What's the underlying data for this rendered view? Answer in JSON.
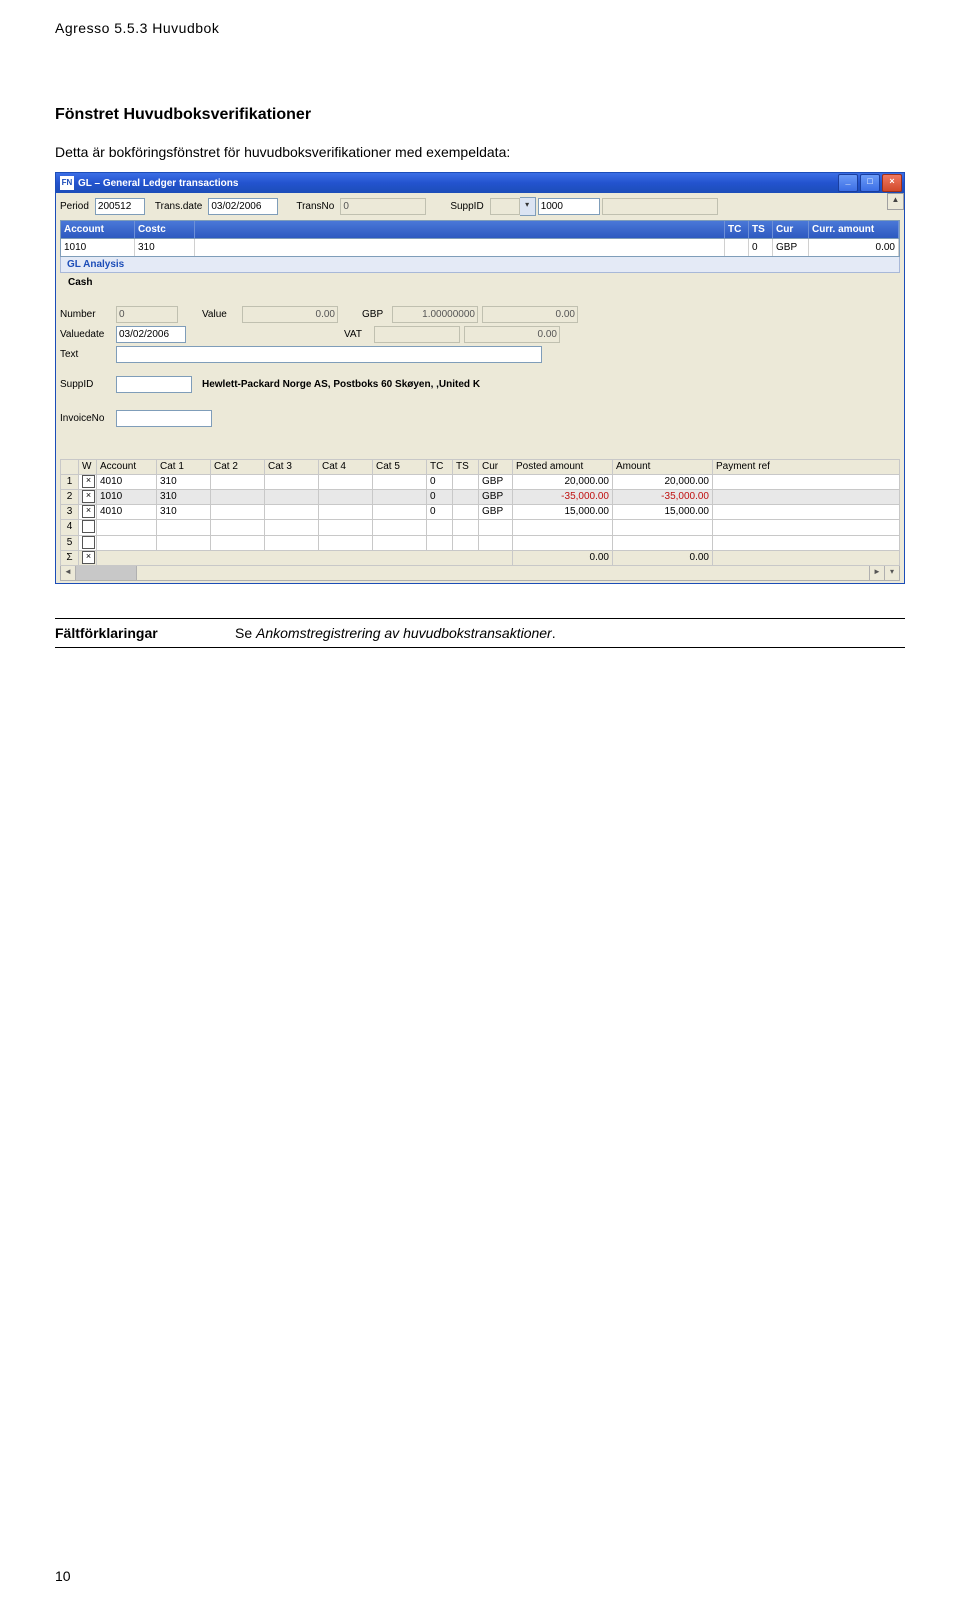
{
  "doc": {
    "running_head": "Agresso 5.5.3 Huvudbok",
    "section_title": "Fönstret Huvudboksverifikationer",
    "intro": "Detta är bokföringsfönstret för huvudboksverifikationer med exempeldata:",
    "page_number": "10"
  },
  "win": {
    "icon_text": "FN",
    "title": "GL – General Ledger transactions",
    "min": "_",
    "max": "□",
    "close": "×",
    "scroll_up": "▲"
  },
  "topline": {
    "period_lbl": "Period",
    "period_val": "200512",
    "transdate_lbl": "Trans.date",
    "transdate_val": "03/02/2006",
    "transno_lbl": "TransNo",
    "transno_val": "0",
    "suppid_lbl": "SuppID",
    "suppid_val": "1000",
    "dd": "▾"
  },
  "ht_headers": {
    "account": "Account",
    "costc": "Costc",
    "tc": "TC",
    "ts": "TS",
    "cur": "Cur",
    "curramt": "Curr. amount"
  },
  "ht_row": {
    "account": "1010",
    "costc": "310",
    "tc": "",
    "ts": "0",
    "cur": "GBP",
    "curramt": "0.00"
  },
  "gl_analysis": "GL Analysis",
  "cash_hdr": "Cash",
  "vals": {
    "number_lbl": "Number",
    "number_val": "0",
    "value_lbl": "Value",
    "value_val": "0.00",
    "gbp_lbl": "GBP",
    "gbp_rate": "1.00000000",
    "gbp_amt": "0.00",
    "valuedate_lbl": "Valuedate",
    "valuedate_val": "03/02/2006",
    "vat_lbl": "VAT",
    "vat_val": "0.00",
    "text_lbl": "Text",
    "text_val": "",
    "suppid_lbl": "SuppID",
    "suppid_val": "",
    "supp_desc": "Hewlett-Packard Norge AS, Postboks 60 Skøyen, ,United K",
    "invno_lbl": "InvoiceNo",
    "invno_val": ""
  },
  "grid": {
    "headers": {
      "row": "",
      "w": "W",
      "account": "Account",
      "cat1": "Cat 1",
      "cat2": "Cat 2",
      "cat3": "Cat 3",
      "cat4": "Cat 4",
      "cat5": "Cat 5",
      "tc": "TC",
      "ts": "TS",
      "cur": "Cur",
      "posted": "Posted amount",
      "amount": "Amount",
      "payref": "Payment ref"
    },
    "rows": [
      {
        "n": "1",
        "chk": "⊠",
        "account": "4010",
        "cat1": "310",
        "cat2": "",
        "cat3": "",
        "cat4": "",
        "cat5": "",
        "tc": "0",
        "ts": "",
        "cur": "GBP",
        "posted": "20,000.00",
        "amount": "20,000.00",
        "payref": ""
      },
      {
        "n": "2",
        "chk": "⊠",
        "account": "1010",
        "cat1": "310",
        "cat2": "",
        "cat3": "",
        "cat4": "",
        "cat5": "",
        "tc": "0",
        "ts": "",
        "cur": "GBP",
        "posted": "-35,000.00",
        "amount": "-35,000.00",
        "payref": "",
        "neg": true,
        "sel": true
      },
      {
        "n": "3",
        "chk": "⊠",
        "account": "4010",
        "cat1": "310",
        "cat2": "",
        "cat3": "",
        "cat4": "",
        "cat5": "",
        "tc": "0",
        "ts": "",
        "cur": "GBP",
        "posted": "15,000.00",
        "amount": "15,000.00",
        "payref": ""
      },
      {
        "n": "4",
        "chk": "",
        "account": "",
        "cat1": "",
        "cat2": "",
        "cat3": "",
        "cat4": "",
        "cat5": "",
        "tc": "",
        "ts": "",
        "cur": "",
        "posted": "",
        "amount": "",
        "payref": ""
      },
      {
        "n": "5",
        "chk": "",
        "account": "",
        "cat1": "",
        "cat2": "",
        "cat3": "",
        "cat4": "",
        "cat5": "",
        "tc": "",
        "ts": "",
        "cur": "",
        "posted": "",
        "amount": "",
        "payref": ""
      }
    ],
    "sum": {
      "sigma": "Σ",
      "chk": "⊠",
      "posted": "0.00",
      "amount": "0.00"
    },
    "scroll": {
      "left": "◄",
      "right": "►",
      "down": "▾"
    }
  },
  "field_table": {
    "heading": "Fältförklaringar",
    "text_prefix": "Se ",
    "text_em": "Ankomstregistrering av huvudbokstransaktioner",
    "text_suffix": "."
  }
}
